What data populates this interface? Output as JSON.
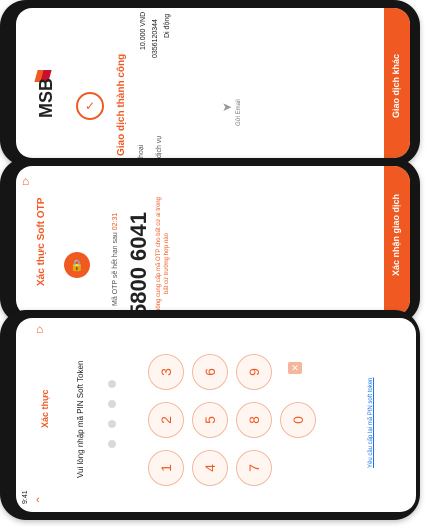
{
  "screen_success": {
    "brand": "MSB",
    "title": "Giao dịch thành công",
    "rows": [
      {
        "label": "hoại",
        "value": "0356120344"
      },
      {
        "label": "dịch vụ",
        "value": "Di động"
      }
    ],
    "amount": "10.000 VND",
    "email_label": "Gửi Email",
    "button": "Giao dịch khác"
  },
  "screen_otp": {
    "title": "Xác thực Soft OTP",
    "expire_text": "Mã OTP sẽ hết hạn sau",
    "expire_time": "02:31",
    "otp_code": "5800 6041",
    "warning_line1": "Không cung cấp mã OTP cho bất cứ ai trong",
    "warning_line2": "bất cứ trường hợp nào",
    "button": "Xác nhận giao dịch"
  },
  "screen_pin": {
    "time": "9:41",
    "title": "Xác thực",
    "prompt": "Vui lòng nhập mã PIN Soft Token",
    "keys": [
      "1",
      "2",
      "3",
      "4",
      "5",
      "6",
      "7",
      "8",
      "9",
      "0"
    ],
    "forgot_link": "Yêu cầu cấp lại mã PIN soft token"
  },
  "colors": {
    "accent": "#f05a22",
    "key_border": "#f4b79d"
  },
  "icons": [
    "back-chevron-icon",
    "backspace-icon",
    "shield-lock-icon",
    "check-circle-icon",
    "send-icon",
    "home-icon"
  ]
}
